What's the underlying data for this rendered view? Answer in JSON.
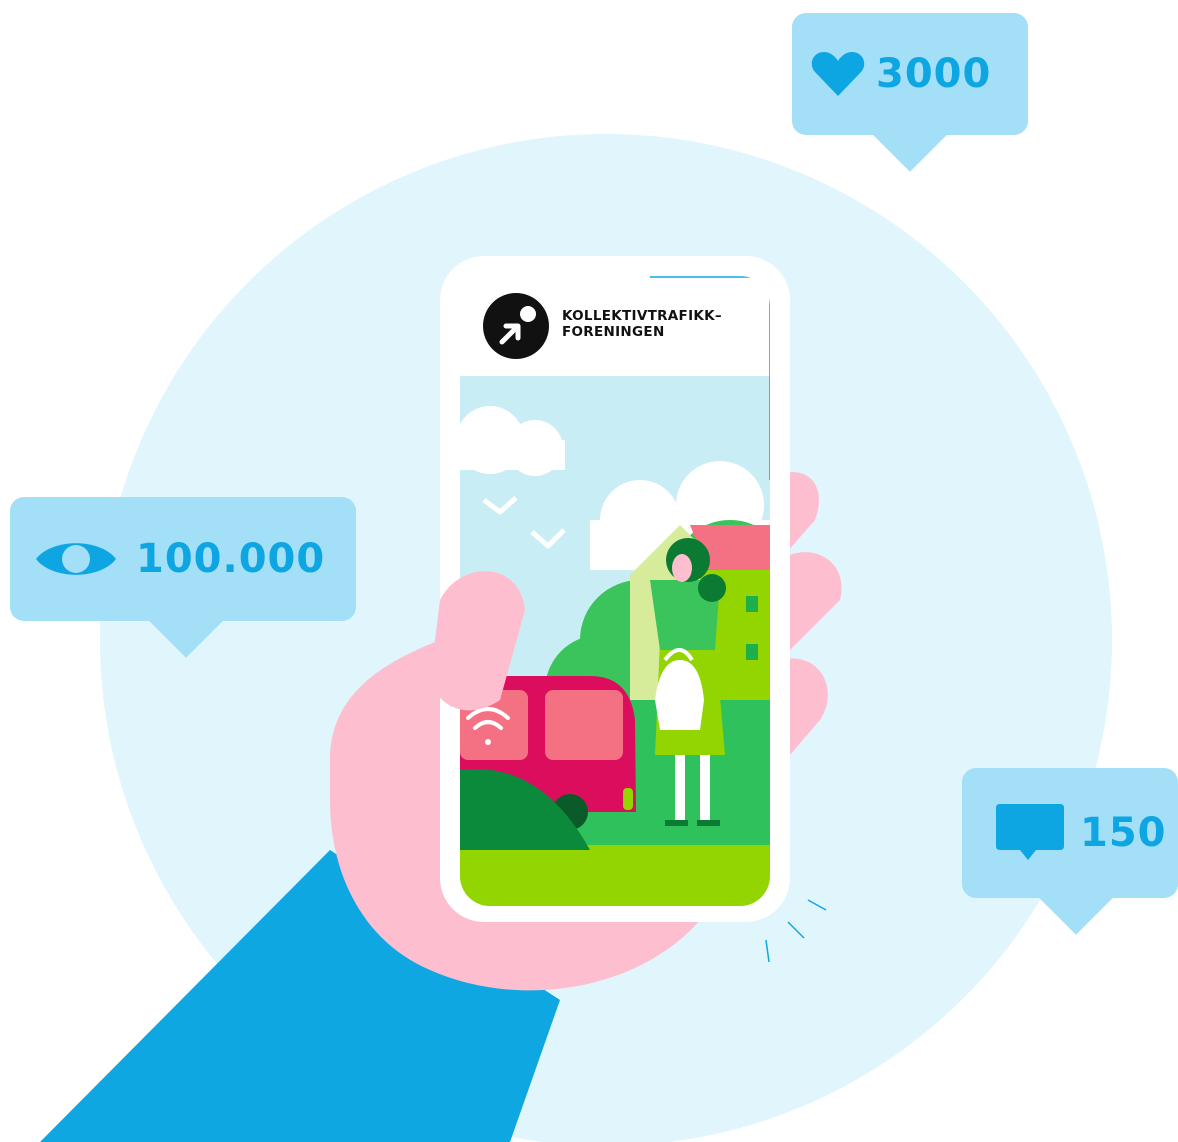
{
  "stats": {
    "likes": {
      "icon": "heart-icon",
      "value": "3000"
    },
    "views": {
      "icon": "eye-icon",
      "value": "100.000"
    },
    "comments": {
      "icon": "comment-icon",
      "value": "150"
    }
  },
  "phone": {
    "logo": {
      "icon": "kollektivtrafikk-logo",
      "line1": "KOLLEKTIVTRAFIKK–",
      "line2": "FORENINGEN"
    },
    "bus_icon": "wifi-icon"
  },
  "colors": {
    "bubble": "#a3dff6",
    "stat_text": "#0ea5e3",
    "circle": "#e0f5fc",
    "sleeve": "#0fa7e2",
    "hand": "#fdbfd0",
    "bus": "#dc0d5c",
    "sky": "#c8edf5",
    "grass": "#93d500"
  }
}
